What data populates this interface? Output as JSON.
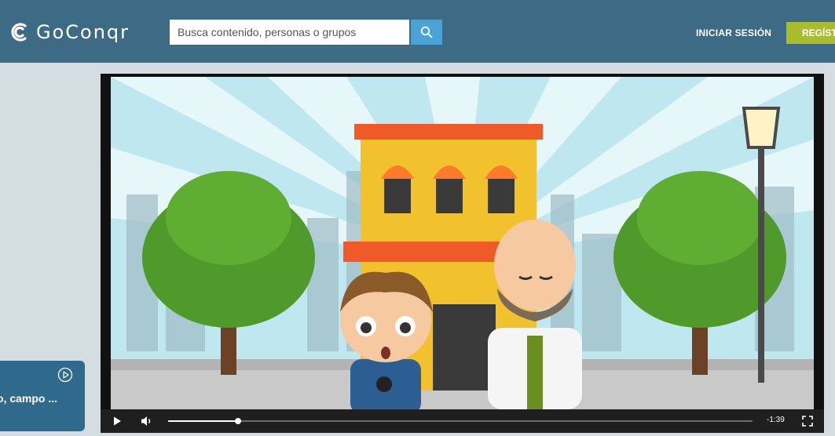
{
  "header": {
    "logo_text": "GoConqr",
    "search": {
      "placeholder": "Busca contenido, personas o grupos",
      "value": ""
    },
    "login_label": "INICIAR SESIÓN",
    "register_label": "REGÍST"
  },
  "side_panel": {
    "title": "o, campo ..."
  },
  "video": {
    "time_remaining": "-1:39",
    "progress": 0.12
  },
  "colors": {
    "header": "#3d6a84",
    "search_button": "#4aa3d6",
    "register_button": "#a9bc2e",
    "page_background": "#d4dde2"
  },
  "icons": [
    "goconqr-logo-icon",
    "search-icon",
    "play-circle-icon",
    "play-icon",
    "volume-icon",
    "fullscreen-icon"
  ]
}
